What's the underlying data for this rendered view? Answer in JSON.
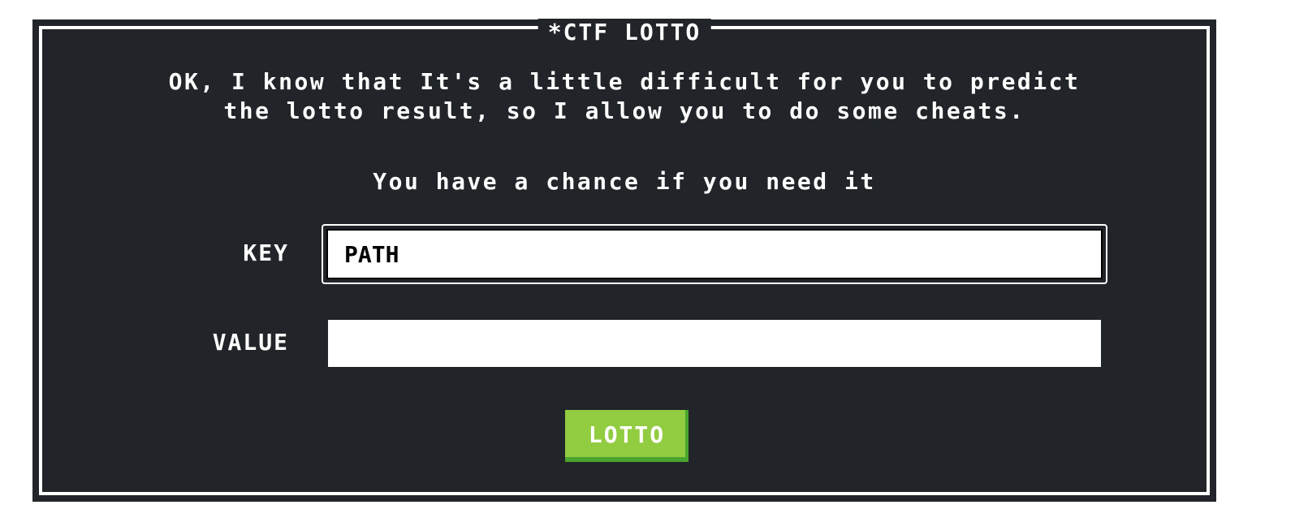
{
  "dialog": {
    "title": "*CTF LOTTO",
    "intro_line1": "OK, I know that It's a little difficult for you to predict",
    "intro_line2": "the lotto result, so I allow you to do some cheats.",
    "chance_text": "You have a chance if you need it"
  },
  "form": {
    "key_label": "KEY",
    "key_value": "PATH",
    "value_label": "VALUE",
    "value_value": "",
    "submit_label": "LOTTO"
  },
  "colors": {
    "background": "#212529",
    "border": "#ffffff",
    "button": "#92cc41",
    "button_shadow": "#4aa52e"
  }
}
